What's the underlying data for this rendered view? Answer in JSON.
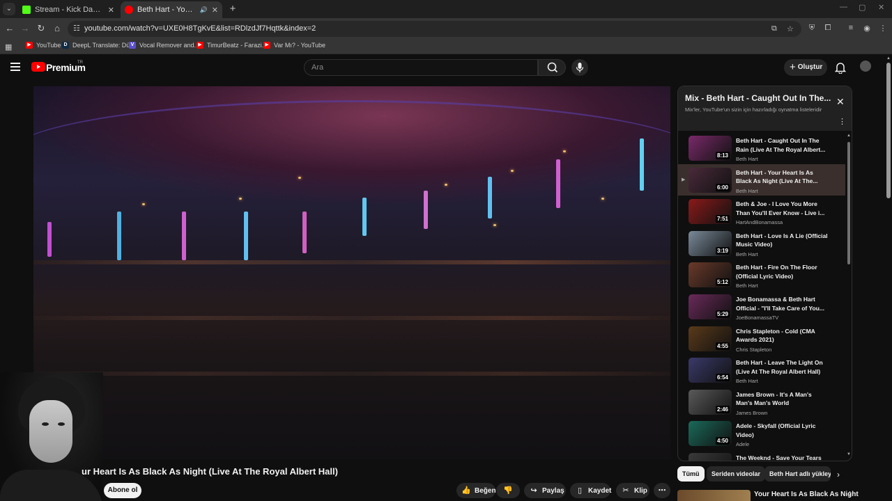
{
  "browser": {
    "tabs": [
      {
        "label": "Stream - Kick Dashboard",
        "favicon_color": "#53fc18"
      },
      {
        "label": "Beth Hart - Your Heart Is As",
        "favicon_color": "#ff0000"
      }
    ],
    "url": "youtube.com/watch?v=UXE0H8TgKvE&list=RDlzdJf7Hqttk&index=2",
    "bookmarks": [
      {
        "label": "YouTube",
        "color": "#ff0000",
        "glyph": "▶"
      },
      {
        "label": "DeepL Translate: Dü...",
        "color": "#0f2b46",
        "glyph": "D"
      },
      {
        "label": "Vocal Remover and...",
        "color": "#5a4fcf",
        "glyph": "V"
      },
      {
        "label": "TimurBeatz - Farazi...",
        "color": "#ff0000",
        "glyph": "▶"
      },
      {
        "label": "Var Mı? - YouTube",
        "color": "#ff0000",
        "glyph": "▶"
      }
    ]
  },
  "youtube": {
    "brand": "Premium",
    "country": "TR",
    "search_placeholder": "Ara",
    "create_label": "Oluştur"
  },
  "video": {
    "title": "ur Heart Is As Black As Night (Live At The Royal Albert Hall)",
    "subscribe_label": "Abone ol",
    "actions": [
      {
        "label": "Beğen",
        "icon": "thumbs-up-icon"
      },
      {
        "label": "",
        "icon": "thumbs-down-icon"
      },
      {
        "label": "Paylaş",
        "icon": "share-icon"
      },
      {
        "label": "Kaydet",
        "icon": "bookmark-icon"
      },
      {
        "label": "Klip",
        "icon": "scissors-icon"
      },
      {
        "label": "",
        "icon": "more-icon"
      }
    ]
  },
  "playlist": {
    "title": "Mix - Beth Hart - Caught Out In The...",
    "subtitle": "Mix'ler, YouTube'un sizin için hazırladığı oynatma listeleridir",
    "items": [
      {
        "title": "Beth Hart - Caught Out In The Rain (Live At The Royal Albert...",
        "channel": "Beth Hart",
        "duration": "8:13",
        "thumb": "#7a2a6a",
        "current": false
      },
      {
        "title": "Beth Hart - Your Heart Is As Black As Night (Live At The...",
        "channel": "Beth Hart",
        "duration": "6:00",
        "thumb": "#4a2a3a",
        "current": true
      },
      {
        "title": "Beth & Joe - I Love You More Than You'll Ever Know - Live i...",
        "channel": "HartAndBonamassa",
        "duration": "7:51",
        "thumb": "#8a1a1a",
        "current": false
      },
      {
        "title": "Beth Hart - Love Is A Lie (Official Music Video)",
        "channel": "Beth Hart",
        "duration": "3:19",
        "thumb": "#7a8a9a",
        "current": false
      },
      {
        "title": "Beth Hart - Fire On The Floor (Official Lyric Video)",
        "channel": "Beth Hart",
        "duration": "5:12",
        "thumb": "#6a3a2a",
        "current": false
      },
      {
        "title": "Joe Bonamassa & Beth Hart Official - \"I'll Take Care of You...",
        "channel": "JoeBonamassaTV",
        "duration": "5:29",
        "thumb": "#6a2a5a",
        "current": false
      },
      {
        "title": "Chris Stapleton - Cold (CMA Awards 2021)",
        "channel": "Chris Stapleton",
        "duration": "4:55",
        "thumb": "#5a3a1a",
        "current": false
      },
      {
        "title": "Beth Hart - Leave The Light On (Live At The Royal Albert Hall)",
        "channel": "Beth Hart",
        "duration": "6:54",
        "thumb": "#3a3a6a",
        "current": false
      },
      {
        "title": "James Brown - It's A Man's Man's Man's World",
        "channel": "James Brown",
        "duration": "2:46",
        "thumb": "#5a5a5a",
        "current": false
      },
      {
        "title": "Adele - Skyfall (Official Lyric Video)",
        "channel": "Adele",
        "duration": "4:50",
        "thumb": "#1a6a5a",
        "current": false
      },
      {
        "title": "The Weeknd - Save Your Tears",
        "channel": "",
        "duration": "",
        "thumb": "#3a3a3a",
        "current": false
      }
    ]
  },
  "chips": [
    "Tümü",
    "Seriden videolar",
    "Beth Hart adlı yükley"
  ],
  "recommendation": {
    "title": "Your Heart Is As Black As Night"
  }
}
